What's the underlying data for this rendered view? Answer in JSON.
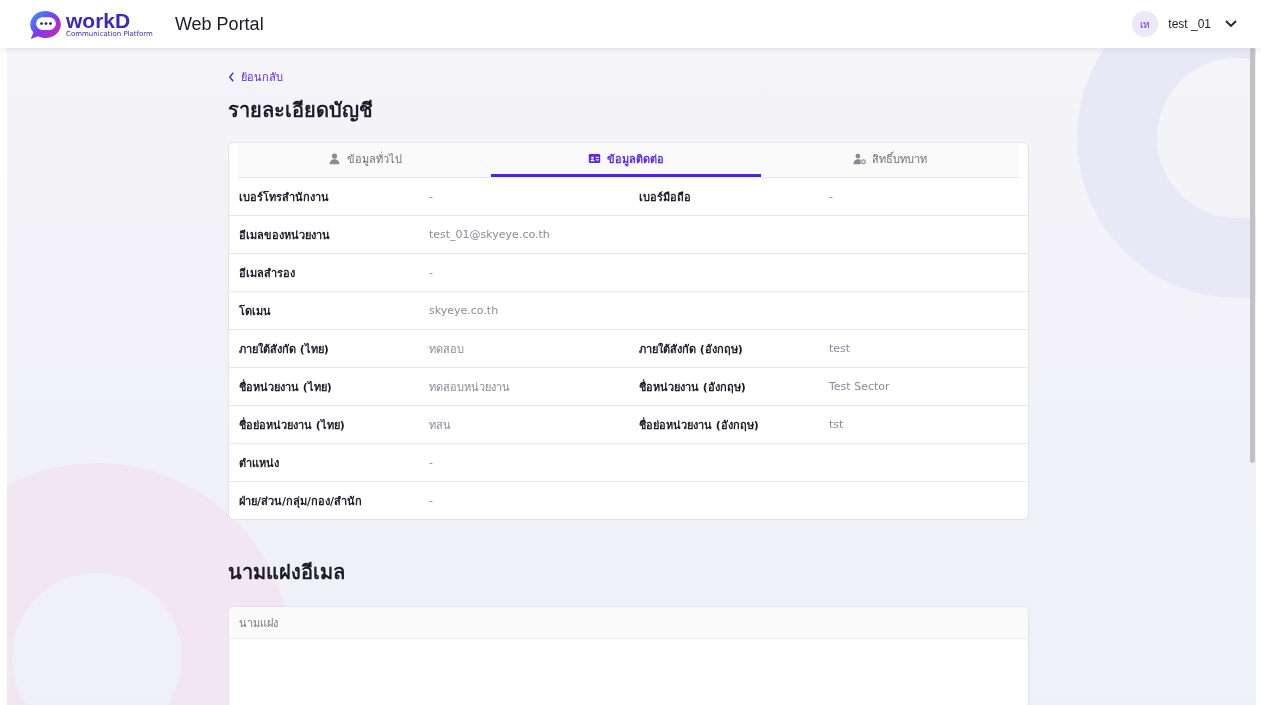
{
  "header": {
    "logo_text": "workD",
    "logo_tagline": "Communication Platform",
    "title": "Web Portal",
    "user": {
      "initials": "เห",
      "name": "test _01"
    }
  },
  "back_link": "ย้อนกลับ",
  "page_title": "รายละเอียดบัญชี",
  "tabs": [
    {
      "label": "ข้อมูลทั่วไป",
      "selected": false
    },
    {
      "label": "ข้อมูลติดต่อ",
      "selected": true
    },
    {
      "label": "สิทธิ์บทบาท",
      "selected": false
    }
  ],
  "rows": [
    {
      "fields": [
        {
          "label": "เบอร์โทรสำนักงาน",
          "value": "-"
        },
        {
          "label": "เบอร์มือถือ",
          "value": "-"
        }
      ]
    },
    {
      "fields": [
        {
          "label": "อีเมลของหน่วยงาน",
          "value": "test_01@skyeye.co.th"
        }
      ]
    },
    {
      "fields": [
        {
          "label": "อีเมลสำรอง",
          "value": "-"
        }
      ]
    },
    {
      "fields": [
        {
          "label": "โดเมน",
          "value": "skyeye.co.th"
        }
      ]
    },
    {
      "fields": [
        {
          "label": "ภายใต้สังกัด (ไทย)",
          "value": "ทดสอบ"
        },
        {
          "label": "ภายใต้สังกัด (อังกฤษ)",
          "value": "test"
        }
      ]
    },
    {
      "fields": [
        {
          "label": "ชื่อหน่วยงาน (ไทย)",
          "value": "ทดสอบหน่วยงาน"
        },
        {
          "label": "ชื่อหน่วยงาน (อังกฤษ)",
          "value": "Test Sector"
        }
      ]
    },
    {
      "fields": [
        {
          "label": "ชื่อย่อหน่วยงาน (ไทย)",
          "value": "ทสน"
        },
        {
          "label": "ชื่อย่อหน่วยงาน (อังกฤษ)",
          "value": "tst"
        }
      ]
    },
    {
      "fields": [
        {
          "label": "ตำแหน่ง",
          "value": "-"
        }
      ]
    },
    {
      "fields": [
        {
          "label": "ฝ่าย/ส่วน/กลุ่ม/กอง/สำนัก",
          "value": "-"
        }
      ]
    }
  ],
  "signature_section": {
    "title": "นามแฝงอีเมล",
    "table": {
      "columns": [
        "นามแฝง"
      ]
    }
  }
}
